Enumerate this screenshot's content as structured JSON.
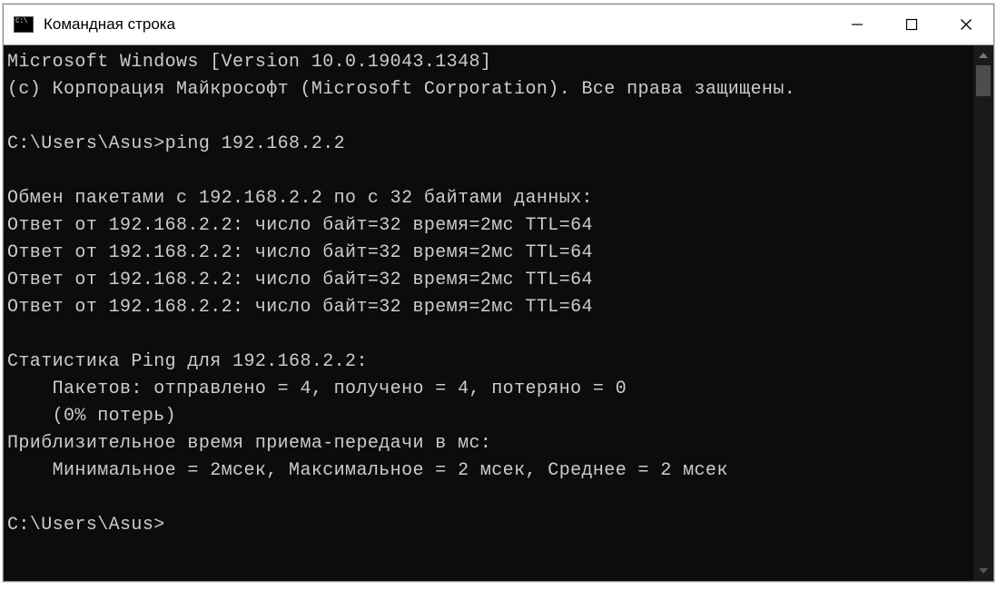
{
  "window": {
    "title": "Командная строка"
  },
  "terminal": {
    "lines": [
      "Microsoft Windows [Version 10.0.19043.1348]",
      "(c) Корпорация Майкрософт (Microsoft Corporation). Все права защищены.",
      "",
      "C:\\Users\\Asus>ping 192.168.2.2",
      "",
      "Обмен пакетами с 192.168.2.2 по с 32 байтами данных:",
      "Ответ от 192.168.2.2: число байт=32 время=2мс TTL=64",
      "Ответ от 192.168.2.2: число байт=32 время=2мс TTL=64",
      "Ответ от 192.168.2.2: число байт=32 время=2мс TTL=64",
      "Ответ от 192.168.2.2: число байт=32 время=2мс TTL=64",
      "",
      "Статистика Ping для 192.168.2.2:",
      "    Пакетов: отправлено = 4, получено = 4, потеряно = 0",
      "    (0% потерь)",
      "Приблизительное время приема-передачи в мс:",
      "    Минимальное = 2мсек, Максимальное = 2 мсек, Среднее = 2 мсек",
      "",
      "C:\\Users\\Asus>"
    ]
  }
}
